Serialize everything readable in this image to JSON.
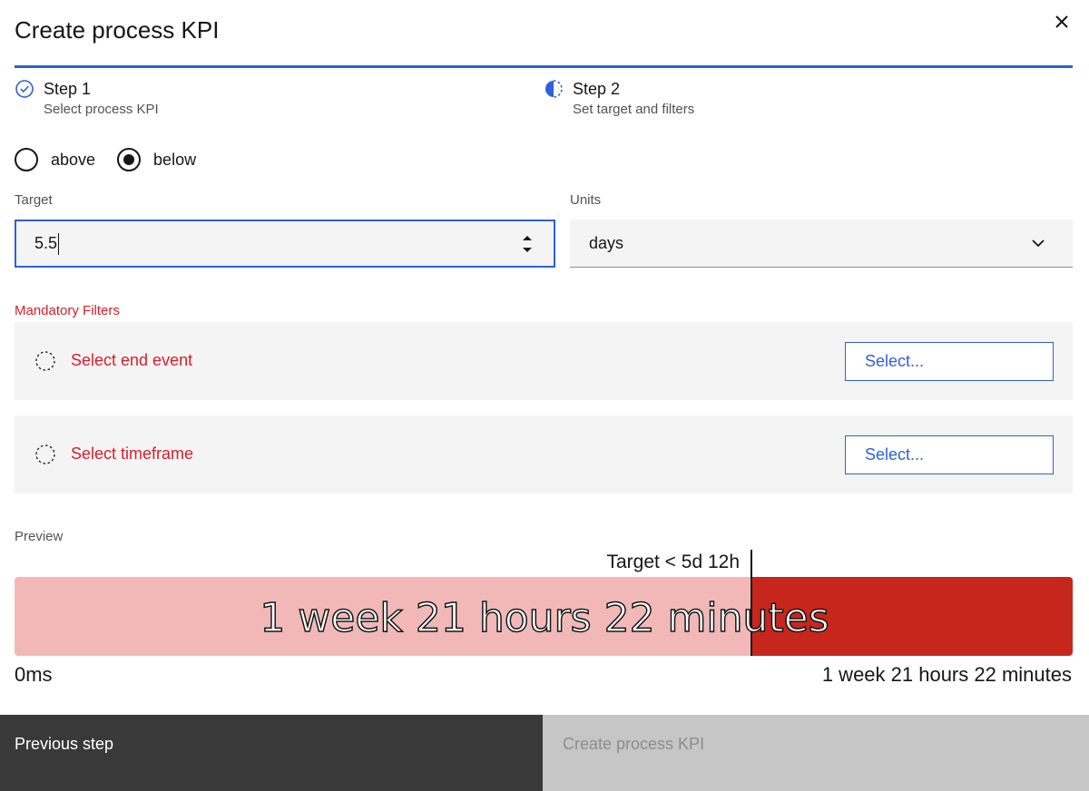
{
  "modal": {
    "title": "Create process KPI",
    "close_icon": "close-icon"
  },
  "steps": [
    {
      "label": "Step 1",
      "sub": "Select process KPI",
      "status": "complete",
      "icon": "checkmark-circle-icon"
    },
    {
      "label": "Step 2",
      "sub": "Set target and filters",
      "status": "current",
      "icon": "half-circle-icon"
    }
  ],
  "direction": {
    "options": [
      {
        "label": "above",
        "selected": false
      },
      {
        "label": "below",
        "selected": true
      }
    ]
  },
  "target": {
    "label": "Target",
    "value": "5.5"
  },
  "units": {
    "label": "Units",
    "value": "days"
  },
  "filters": {
    "label": "Mandatory Filters",
    "items": [
      {
        "text": "Select end event",
        "button": "Select..."
      },
      {
        "text": "Select timeframe",
        "button": "Select..."
      }
    ]
  },
  "preview": {
    "label": "Preview",
    "target_text": "Target < 5d 12h",
    "value_text": "1 week 21 hours 22 minutes",
    "min_label": "0ms",
    "max_label": "1 week 21 hours 22 minutes",
    "target_fraction": 0.696
  },
  "footer": {
    "previous_label": "Previous step",
    "create_label": "Create process KPI"
  },
  "colors": {
    "accent": "#2f5fd9",
    "error": "#da1e28",
    "bar_below": "#f2b8b8",
    "bar_above": "#c7261c"
  }
}
